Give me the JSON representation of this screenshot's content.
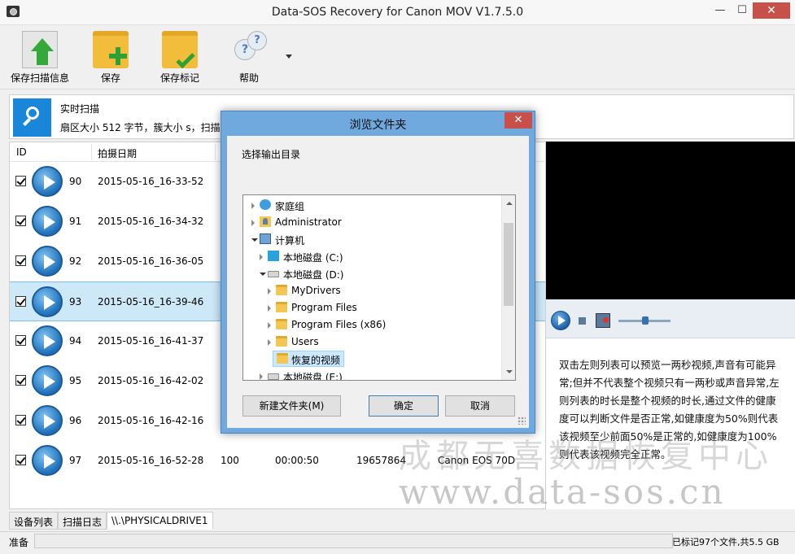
{
  "window": {
    "title": "Data-SOS Recovery for Canon MOV V1.7.5.0",
    "min_label": "—",
    "max_label": "☐",
    "close_label": "✕"
  },
  "toolbar": {
    "save_scan_info": "保存扫描信息",
    "save": "保存",
    "save_marked": "保存标记",
    "help": "帮助"
  },
  "scan": {
    "title": "实时扫描",
    "detail": "扇区大小 512 字节，簇大小 s，扫描"
  },
  "list": {
    "columns": {
      "id": "ID",
      "date": "拍摄日期"
    },
    "rows": [
      {
        "id": "90",
        "date": "2015-05-16_16-33-52"
      },
      {
        "id": "91",
        "date": "2015-05-16_16-34-32"
      },
      {
        "id": "92",
        "date": "2015-05-16_16-36-05"
      },
      {
        "id": "93",
        "date": "2015-05-16_16-39-46",
        "selected": true
      },
      {
        "id": "94",
        "date": "2015-05-16_16-41-37"
      },
      {
        "id": "95",
        "date": "2015-05-16_16-42-02"
      },
      {
        "id": "96",
        "date": "2015-05-16_16-42-16"
      },
      {
        "id": "97",
        "date": "2015-05-16_16-52-28",
        "health": "100",
        "duration": "00:00:50",
        "size": "19657864",
        "camera": "Canon EOS 70D"
      }
    ]
  },
  "tabs": {
    "device_list": "设备列表",
    "scan_log": "扫描日志",
    "drive": "\\\\.\\PHYSICALDRIVE1"
  },
  "description": "双击左则列表可以预览一两秒视频,声音有可能异常;但并不代表整个视频只有一两秒或声音异常,左则列表的时长是整个视频的时长,通过文件的健康度可以判断文件是否正常,如健康度为50%则代表该视频至少前面50%是正常的,如健康度为100%则代表该视频完全正常。",
  "status": {
    "left": "准备",
    "right": "已标记97个文件,共5.5 GB"
  },
  "watermark": {
    "line1": "成都无喜数据恢复中心",
    "line2": "www.data-sos.cn"
  },
  "dialog": {
    "title": "浏览文件夹",
    "close_label": "✕",
    "prompt": "选择输出目录",
    "tree": [
      {
        "label": "家庭组",
        "icon": "homegroup-icon"
      },
      {
        "label": "Administrator",
        "icon": "user-folder-icon"
      },
      {
        "label": "计算机",
        "icon": "computer-icon"
      },
      {
        "label": "本地磁盘 (C:)",
        "icon": "windows-drive-icon"
      },
      {
        "label": "本地磁盘 (D:)",
        "icon": "drive-icon"
      },
      {
        "label": "MyDrivers",
        "icon": "folder-icon"
      },
      {
        "label": "Program Files",
        "icon": "folder-icon"
      },
      {
        "label": "Program Files (x86)",
        "icon": "folder-icon"
      },
      {
        "label": "Users",
        "icon": "folder-icon"
      },
      {
        "label": "恢复的视频",
        "icon": "folder-icon",
        "selected": true
      },
      {
        "label": "本地磁盘 (E:)",
        "icon": "drive-icon"
      }
    ],
    "new_folder": "新建文件夹(M)",
    "ok": "确定",
    "cancel": "取消"
  }
}
